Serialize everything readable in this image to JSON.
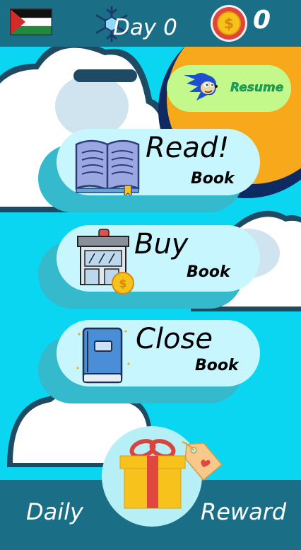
{
  "header": {
    "day_label": "Day 0",
    "coin_count": "0",
    "flag_icon": "palestine-flag-icon",
    "snowflake_icon": "snowflake-icon",
    "coin_icon": "dollar-coin-icon"
  },
  "resume": {
    "label": "Resume",
    "icon": "sonic-character-icon",
    "color": "#c3f98a"
  },
  "menu": [
    {
      "title": "Read!",
      "subtitle": "Book",
      "icon": "open-book-icon"
    },
    {
      "title": "Buy",
      "subtitle": "Book",
      "icon": "shop-icon"
    },
    {
      "title": "Close",
      "subtitle": "Book",
      "icon": "closed-book-icon"
    }
  ],
  "footer": {
    "left_label": "Daily",
    "right_label": "Reward",
    "gift_icon": "gift-box-icon",
    "tag_icon": "heart-tag-icon"
  },
  "colors": {
    "sky": "#0ad6f2",
    "bar": "#1a6f86",
    "sun": "#f7a81b",
    "pill": "#c8f6ff",
    "pill_shadow": "#35b9cc"
  }
}
